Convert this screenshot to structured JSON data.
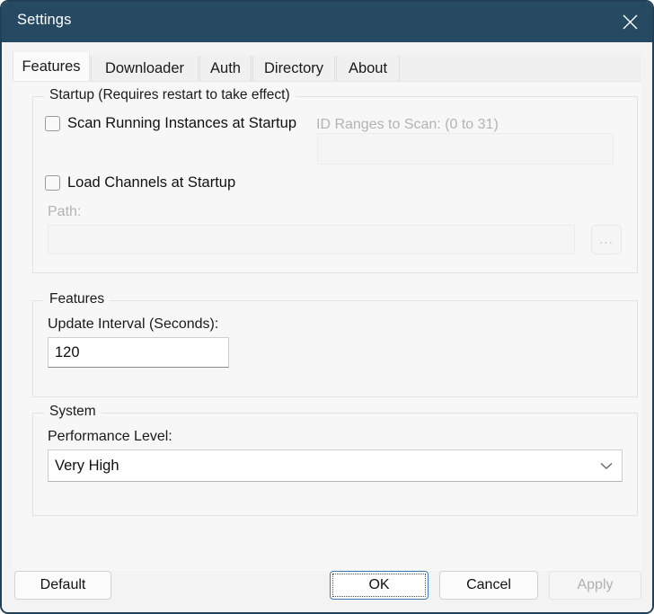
{
  "window": {
    "title": "Settings",
    "close_icon": "close-icon",
    "titlebar_color": "#274a63",
    "border_color": "#234156",
    "background_color": "#f7f7f7"
  },
  "tabs": [
    {
      "label": "Features",
      "active": true
    },
    {
      "label": "Downloader",
      "active": false
    },
    {
      "label": "Auth",
      "active": false
    },
    {
      "label": "Directory",
      "active": false
    },
    {
      "label": "About",
      "active": false
    }
  ],
  "groups": {
    "startup": {
      "title": "Startup (Requires restart to take effect)",
      "scan_checkbox": {
        "label": "Scan Running Instances at Startup",
        "checked": false
      },
      "id_ranges": {
        "label": "ID Ranges to Scan: (0 to 31)",
        "value": "",
        "disabled": true
      },
      "load_checkbox": {
        "label": "Load Channels at Startup",
        "checked": false
      },
      "path": {
        "label": "Path:",
        "value": "",
        "disabled": true,
        "browse_label": "...",
        "browse_disabled": true
      }
    },
    "features": {
      "title": "Features",
      "update_interval": {
        "label": "Update Interval (Seconds):",
        "value": "120",
        "disabled": false
      }
    },
    "system": {
      "title": "System",
      "performance_level": {
        "label": "Performance Level:",
        "value": "Very High",
        "chevron_icon": "chevron-down-icon"
      }
    }
  },
  "footer": {
    "default_label": "Default",
    "ok_label": "OK",
    "cancel_label": "Cancel",
    "apply_label": "Apply",
    "ok_focused": true,
    "apply_disabled": true
  }
}
